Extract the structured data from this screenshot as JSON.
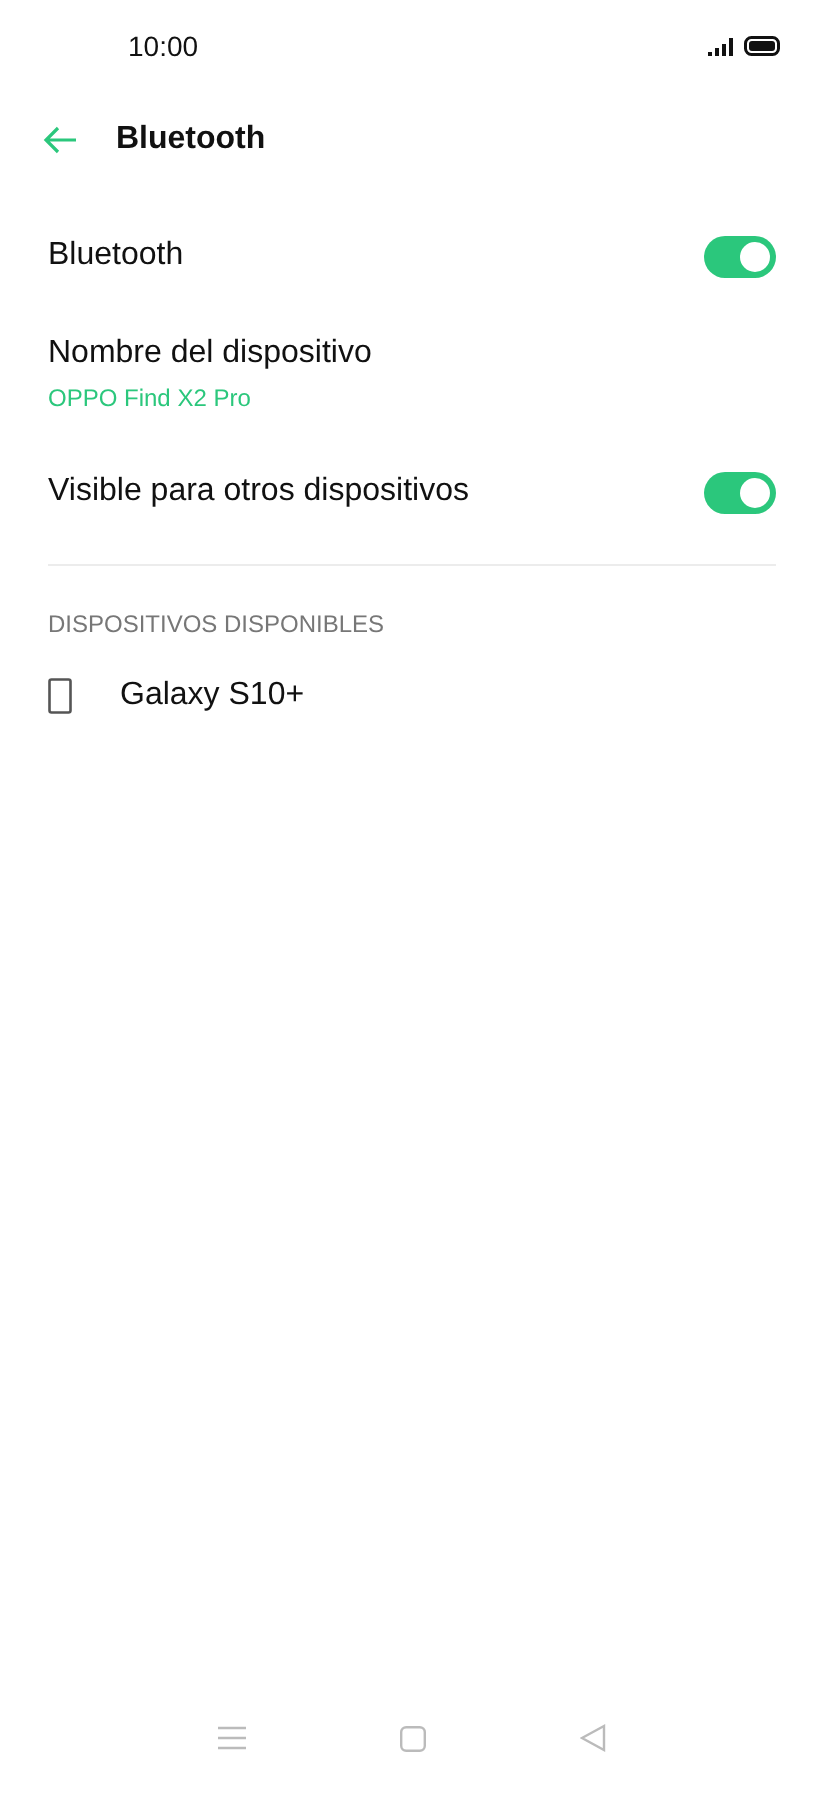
{
  "status_bar": {
    "time": "10:00"
  },
  "header": {
    "title": "Bluetooth"
  },
  "settings": [
    {
      "kind": "toggle",
      "label": "Bluetooth",
      "on": true
    },
    {
      "kind": "value",
      "label": "Nombre del dispositivo",
      "value": "OPPO Find X2 Pro"
    },
    {
      "kind": "toggle",
      "label": "Visible para otros dispositivos",
      "on": true
    }
  ],
  "available_devices": {
    "heading": "DISPOSITIVOS DISPONIBLES",
    "devices": [
      {
        "name": "Galaxy S10+"
      }
    ]
  }
}
